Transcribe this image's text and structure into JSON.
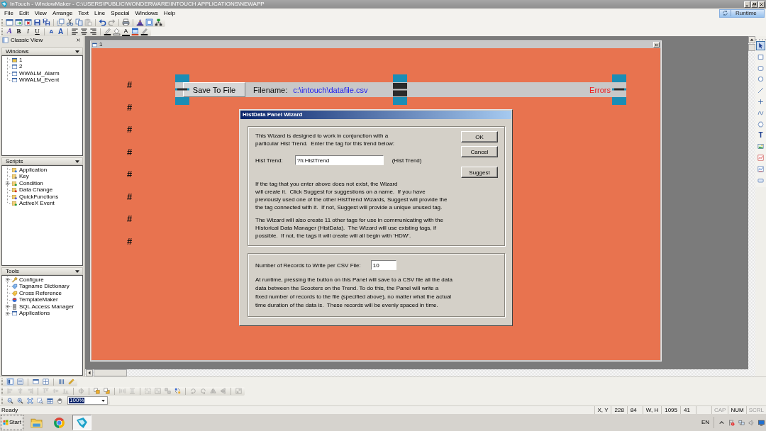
{
  "window": {
    "title": "InTouch - WindowMaker - C:\\USERS\\PUBLIC\\WONDERWARE\\INTOUCH APPLICATIONS\\NEWAPP"
  },
  "menu": [
    "File",
    "Edit",
    "View",
    "Arrange",
    "Text",
    "Line",
    "Special",
    "Windows",
    "Help"
  ],
  "runtime_button": {
    "label": "Runtime"
  },
  "toolbars": {
    "standard": [
      [
        {
          "kind": "new-window",
          "disabled": false
        },
        {
          "kind": "open-window",
          "disabled": false
        },
        {
          "kind": "delete-window",
          "disabled": false
        },
        {
          "kind": "save",
          "disabled": false
        },
        {
          "kind": "save-all",
          "disabled": false
        }
      ],
      [
        {
          "kind": "duplicate",
          "disabled": false
        },
        {
          "kind": "cut",
          "disabled": false
        },
        {
          "kind": "copy",
          "disabled": false
        },
        {
          "kind": "paste",
          "disabled": true
        }
      ],
      [
        {
          "kind": "undo",
          "disabled": false
        },
        {
          "kind": "redo",
          "disabled": true
        }
      ],
      [
        {
          "kind": "print",
          "disabled": false
        }
      ],
      [
        {
          "kind": "wizard",
          "disabled": false
        },
        {
          "kind": "dialog",
          "disabled": false
        },
        {
          "kind": "tree",
          "disabled": false
        }
      ]
    ],
    "format": [
      [
        {
          "kind": "font",
          "text": "A"
        },
        {
          "kind": "bold",
          "text": "B"
        },
        {
          "kind": "italic",
          "text": "I"
        },
        {
          "kind": "underline",
          "text": "U"
        }
      ],
      [
        {
          "kind": "larger",
          "text": "A"
        },
        {
          "kind": "smaller",
          "text": "A"
        }
      ],
      [
        {
          "kind": "align-left"
        },
        {
          "kind": "align-center"
        },
        {
          "kind": "align-right"
        }
      ],
      [
        {
          "kind": "line-color"
        },
        {
          "kind": "fill-color"
        },
        {
          "kind": "text-color",
          "text": "A"
        },
        {
          "kind": "window-color"
        },
        {
          "kind": "line-style"
        }
      ]
    ]
  },
  "sidebar": {
    "title": "Classic View",
    "sections": [
      {
        "title": "Windows",
        "kind": "windows",
        "items": [
          {
            "label": "1",
            "open": true,
            "expandable": false
          },
          {
            "label": "2",
            "open": false,
            "expandable": false
          },
          {
            "label": "WWALM_Alarm",
            "open": false,
            "expandable": false
          },
          {
            "label": "WWALM_Event",
            "open": false,
            "expandable": false
          }
        ]
      },
      {
        "title": "Scripts",
        "kind": "scripts",
        "items": [
          {
            "label": "Application",
            "expandable": false
          },
          {
            "label": "Key",
            "expandable": false
          },
          {
            "label": "Condition",
            "expandable": true
          },
          {
            "label": "Data Change",
            "expandable": false
          },
          {
            "label": "QuickFunctions",
            "expandable": false
          },
          {
            "label": "ActiveX Event",
            "expandable": false
          }
        ]
      },
      {
        "title": "Tools",
        "kind": "tools",
        "items": [
          {
            "label": "Configure",
            "expandable": true
          },
          {
            "label": "Tagname Dictionary",
            "expandable": false
          },
          {
            "label": "Cross Reference",
            "expandable": false
          },
          {
            "label": "TemplateMaker",
            "expandable": false
          },
          {
            "label": "SQL Access Manager",
            "expandable": true
          },
          {
            "label": "Applications",
            "expandable": true
          }
        ]
      }
    ]
  },
  "canvas_window": {
    "title": "1",
    "hash_marks": [
      "#",
      "#",
      "#",
      "#",
      "#",
      "#",
      "#",
      "#"
    ],
    "save_button": "Save To File",
    "filename_label": "Filename:",
    "filename": "c:\\intouch\\datafile.csv",
    "errors_label": "Errors"
  },
  "dialog": {
    "title": "HistData Panel Wizard",
    "intro": [
      "This Wizard is designed to work in conjunction with a",
      "particular Hist Trend.  Enter the tag for this trend below:"
    ],
    "buttons": [
      {
        "label": "OK"
      },
      {
        "label": "Cancel"
      },
      {
        "label": "Suggest"
      }
    ],
    "tag_field": {
      "label": "Hist Trend:",
      "value": "?h:HistTrend",
      "note": "(Hist Trend)"
    },
    "paragraphs": [
      [
        "If the tag that you enter above does not exist, the Wizard",
        "will create it.  Click Suggest for suggestions on a name.  If you have",
        "previously used one of the other HistTrend Wizards, Suggest will provide the",
        "the tag connected with it.  If not, Suggest will provide a unique unused tag."
      ],
      [
        "The Wizard will also create 11 other tags for use in communicating with the",
        "Historical Data Manager (HistData).  The Wizard will use existing tags, if",
        "possible.  If not, the tags it will create will all begin with 'HDW'."
      ]
    ],
    "records_field": {
      "label": "Number of Records to Write per CSV File:",
      "value": "10"
    },
    "runtime_note": [
      "At runtime, pressing the button on this Panel will save to a CSV file all the data",
      "data between the Scooters on the Trend. To do this, the Panel will write a",
      "fixed number of records to the file (specified above), no matter what the actual",
      "time duration of the data is.  These records will be evenly spaced in time."
    ]
  },
  "tool_palette": [
    {
      "kind": "pointer",
      "selected": true
    },
    {
      "kind": "rectangle",
      "selected": false
    },
    {
      "kind": "rounded-rectangle",
      "selected": false
    },
    {
      "kind": "ellipse",
      "selected": false
    },
    {
      "kind": "line",
      "selected": false
    },
    {
      "kind": "hv-line",
      "selected": false
    },
    {
      "kind": "polyline",
      "selected": false
    },
    {
      "kind": "polygon",
      "selected": false
    },
    {
      "kind": "text",
      "text": "T",
      "selected": false
    },
    {
      "kind": "bitmap",
      "selected": false
    },
    {
      "kind": "trend",
      "selected": false
    },
    {
      "kind": "hist-trend",
      "selected": false
    },
    {
      "kind": "button",
      "selected": false
    }
  ],
  "view_toolbar": [
    [
      {
        "kind": "split-view",
        "selected": true
      },
      {
        "kind": "list-view",
        "selected": false
      }
    ],
    [
      {
        "kind": "single-window",
        "selected": false
      },
      {
        "kind": "tile-windows",
        "selected": false
      }
    ],
    [
      {
        "kind": "bars",
        "selected": false
      },
      {
        "kind": "ruler",
        "selected": false
      }
    ]
  ],
  "arrange_toolbar": [
    [
      {
        "kind": "align-lefts",
        "disabled": true
      },
      {
        "kind": "align-centers",
        "disabled": true
      },
      {
        "kind": "align-rights",
        "disabled": true
      }
    ],
    [
      {
        "kind": "align-tops",
        "disabled": true
      },
      {
        "kind": "align-middles",
        "disabled": true
      },
      {
        "kind": "align-bottoms",
        "disabled": true
      }
    ],
    [
      {
        "kind": "center-point",
        "disabled": true
      }
    ],
    [
      {
        "kind": "bring-front",
        "disabled": false
      },
      {
        "kind": "send-back",
        "disabled": false
      }
    ],
    [
      {
        "kind": "space-h",
        "disabled": true
      },
      {
        "kind": "space-v",
        "disabled": true
      }
    ],
    [
      {
        "kind": "make-cell",
        "disabled": true
      },
      {
        "kind": "group",
        "disabled": true
      },
      {
        "kind": "ungroup",
        "disabled": true
      },
      {
        "kind": "break-cell",
        "disabled": false
      }
    ],
    [
      {
        "kind": "rotate-cw",
        "disabled": true
      },
      {
        "kind": "rotate-ccw",
        "disabled": true
      },
      {
        "kind": "flip-h",
        "disabled": true
      },
      {
        "kind": "flip-v",
        "disabled": true
      }
    ],
    [
      {
        "kind": "resize",
        "disabled": true
      }
    ]
  ],
  "zoom_toolbar": {
    "tools": [
      {
        "kind": "zoom-out"
      },
      {
        "kind": "zoom-in"
      },
      {
        "kind": "zoom-fit"
      },
      {
        "kind": "zoom-area"
      },
      {
        "kind": "grid"
      },
      {
        "kind": "pan"
      }
    ],
    "zoom_value": "100%"
  },
  "status_bar": {
    "message": "Ready",
    "fields": [
      "X, Y",
      "228",
      "84",
      "W, H",
      "1095",
      "41"
    ],
    "indicators": [
      {
        "label": "CAP",
        "on": false
      },
      {
        "label": "NUM",
        "on": true
      },
      {
        "label": "SCRL",
        "on": false
      }
    ]
  },
  "taskbar": {
    "start": "Start",
    "apps": [
      {
        "kind": "folder",
        "selected": false
      },
      {
        "kind": "browser",
        "selected": false
      },
      {
        "kind": "intouch",
        "selected": true
      }
    ],
    "language": "EN"
  }
}
